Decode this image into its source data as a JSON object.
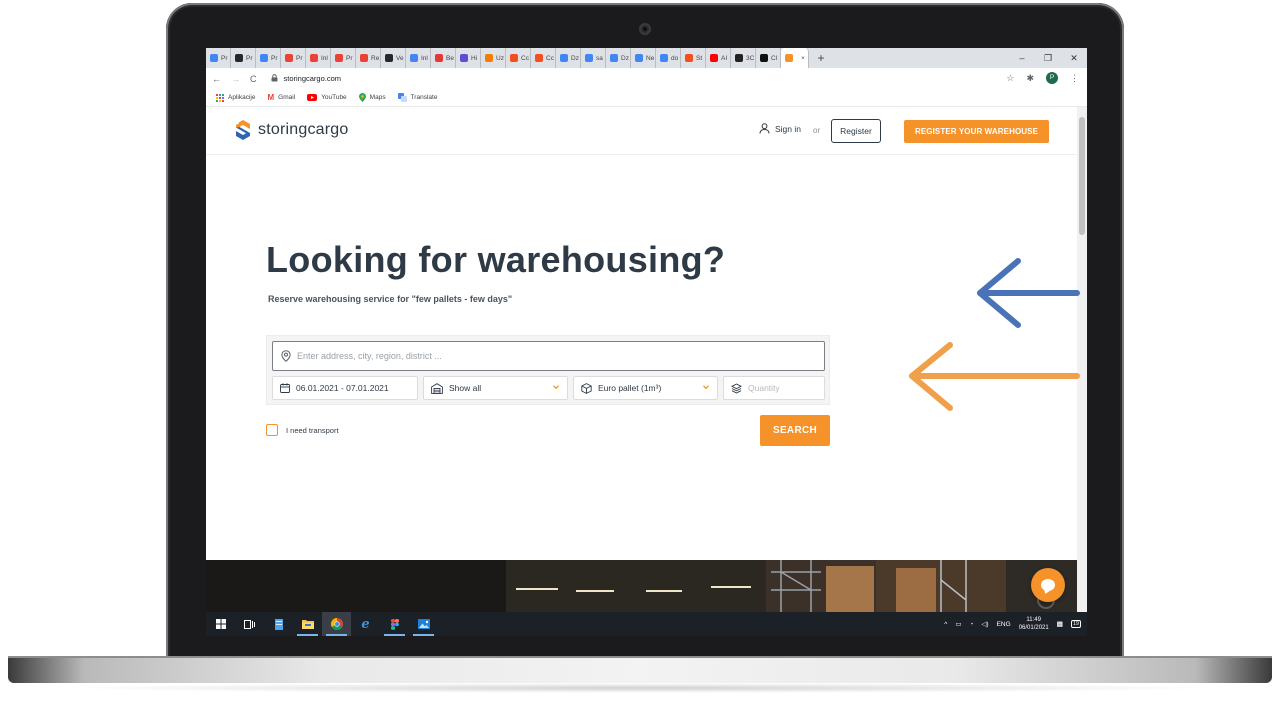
{
  "browser": {
    "tabs": [
      {
        "label": "Pr",
        "icon": "google-icon",
        "color": "#4285f4"
      },
      {
        "label": "Pr",
        "icon": "github-icon",
        "color": "#24292e"
      },
      {
        "label": "Pr",
        "icon": "google-icon",
        "color": "#4285f4"
      },
      {
        "label": "Pr",
        "icon": "gmail-icon",
        "color": "#ea4335"
      },
      {
        "label": "Inl",
        "icon": "gmail-icon",
        "color": "#ea4335"
      },
      {
        "label": "Pr",
        "icon": "gmail-icon",
        "color": "#ea4335"
      },
      {
        "label": "Re",
        "icon": "gmail-icon",
        "color": "#ea4335"
      },
      {
        "label": "Ve",
        "icon": "github-icon",
        "color": "#24292e"
      },
      {
        "label": "Inl",
        "icon": "docs-icon",
        "color": "#4285f4"
      },
      {
        "label": "Be",
        "icon": "red-square-icon",
        "color": "#e53935"
      },
      {
        "label": "Hi",
        "icon": "purple-square-icon",
        "color": "#5b4fd6"
      },
      {
        "label": "Uz",
        "icon": "pinwheel-icon",
        "color": "#f57c00"
      },
      {
        "label": "Cc",
        "icon": "figma-icon",
        "color": "#f24e1e"
      },
      {
        "label": "Cc",
        "icon": "figma-icon",
        "color": "#f24e1e"
      },
      {
        "label": "Dz",
        "icon": "docs-icon",
        "color": "#4285f4"
      },
      {
        "label": "sa",
        "icon": "google-icon",
        "color": "#4285f4"
      },
      {
        "label": "Dz",
        "icon": "docs-icon",
        "color": "#4285f4"
      },
      {
        "label": "Ne",
        "icon": "docs-icon",
        "color": "#4285f4"
      },
      {
        "label": "do",
        "icon": "google-icon",
        "color": "#4285f4"
      },
      {
        "label": "St",
        "icon": "figma-icon",
        "color": "#f24e1e"
      },
      {
        "label": "AI",
        "icon": "youtube-icon",
        "color": "#ff0000"
      },
      {
        "label": "3C",
        "icon": "dark-square-icon",
        "color": "#222222"
      },
      {
        "label": "Cl",
        "icon": "dark-square-icon",
        "color": "#111111"
      },
      {
        "label": "",
        "icon": "storingcargo-icon",
        "color": "#f5922a",
        "active": true
      }
    ],
    "new_tab": "+",
    "close_tab": "×",
    "window_controls": [
      "–",
      "❐",
      "✕"
    ],
    "url": "storingcargo.com",
    "profile_initial": "P",
    "bookmarks": [
      {
        "label": "Aplikacije",
        "icon": "apps-grid-icon"
      },
      {
        "label": "Gmail",
        "icon": "gmail-icon"
      },
      {
        "label": "YouTube",
        "icon": "youtube-icon"
      },
      {
        "label": "Maps",
        "icon": "maps-pin-icon"
      },
      {
        "label": "Translate",
        "icon": "translate-icon"
      }
    ]
  },
  "site": {
    "logo_text_bold": "storing",
    "logo_text_light": "cargo",
    "sign_in": "Sign in",
    "or": "or",
    "register": "Register",
    "register_warehouse": "REGISTER YOUR WAREHOUSE",
    "hero_title": "Looking for warehousing?",
    "hero_subtitle": "Reserve warehousing service for \"few pallets - few days\"",
    "address_placeholder": "Enter address, city, region, district ...",
    "date_range": "06.01.2021 - 07.01.2021",
    "warehouse_type": "Show all",
    "pallet_type": "Euro pallet (1m³)",
    "quantity_placeholder": "Quantity",
    "transport_label": "I need transport",
    "search_button": "SEARCH",
    "accent_color": "#f5922a",
    "text_color": "#2e3a46"
  },
  "taskbar": {
    "items": [
      "windows-start-icon",
      "task-view-icon",
      "notepad-icon",
      "file-explorer-icon",
      "chrome-icon",
      "edge-icon",
      "figma-icon",
      "photos-icon"
    ],
    "language": "ENG",
    "time": "11:49",
    "date": "06/01/2021",
    "notifications": "19"
  },
  "annotations": {
    "arrow_colors": [
      "#4a72b8",
      "#f0a04b"
    ]
  }
}
